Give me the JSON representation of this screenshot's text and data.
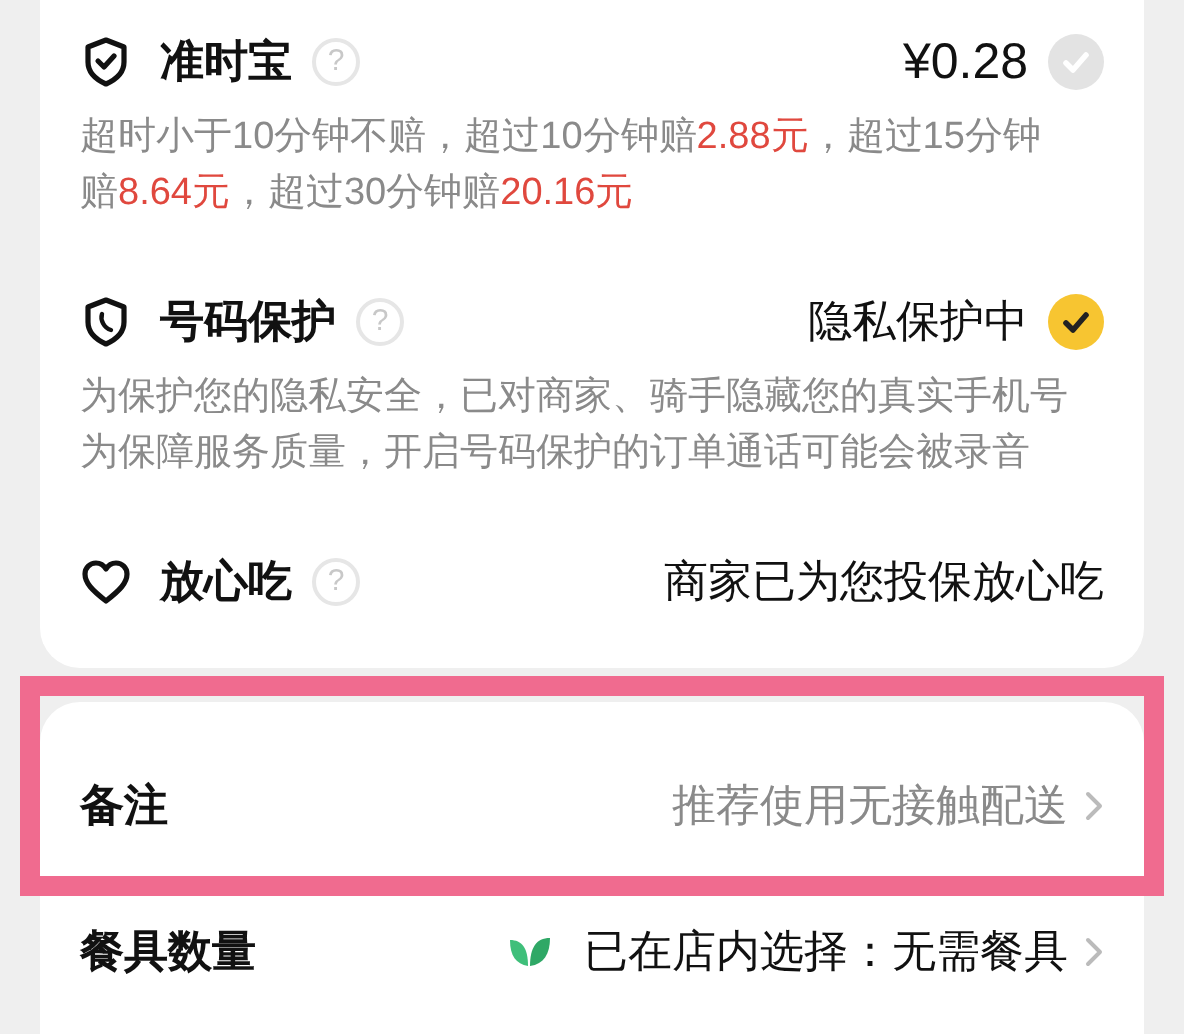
{
  "services": [
    {
      "kind": "on-time",
      "title": "准时宝",
      "help": "?",
      "value": "¥0.28",
      "checked": false,
      "description": [
        [
          {
            "text": "超时小于10分钟不赔，超过10分钟赔",
            "amount": false
          },
          {
            "text": "2.88元",
            "amount": true
          },
          {
            "text": "，超过15分钟",
            "amount": false
          }
        ],
        [
          {
            "text": "赔",
            "amount": false
          },
          {
            "text": "8.64元",
            "amount": true
          },
          {
            "text": "，超过30分钟赔",
            "amount": false
          },
          {
            "text": "20.16元",
            "amount": true
          }
        ]
      ]
    },
    {
      "kind": "phone",
      "title": "号码保护",
      "help": "?",
      "value": "隐私保护中",
      "checked": true,
      "description": [
        [
          {
            "text": "为保护您的隐私安全，已对商家、骑手隐藏您的真实手机号",
            "amount": false
          }
        ],
        [
          {
            "text": "为保障服务质量，开启号码保护的订单通话可能会被录音",
            "amount": false
          }
        ]
      ]
    },
    {
      "kind": "heart",
      "title": "放心吃",
      "help": "?",
      "value": "商家已为您投保放心吃"
    }
  ],
  "order_options": [
    {
      "kind": "note",
      "label": "备注",
      "value": "推荐使用无接触配送",
      "highlighted": true
    },
    {
      "kind": "cutlery",
      "label": "餐具数量",
      "value": "已在店内选择：无需餐具",
      "highlighted": false
    }
  ]
}
